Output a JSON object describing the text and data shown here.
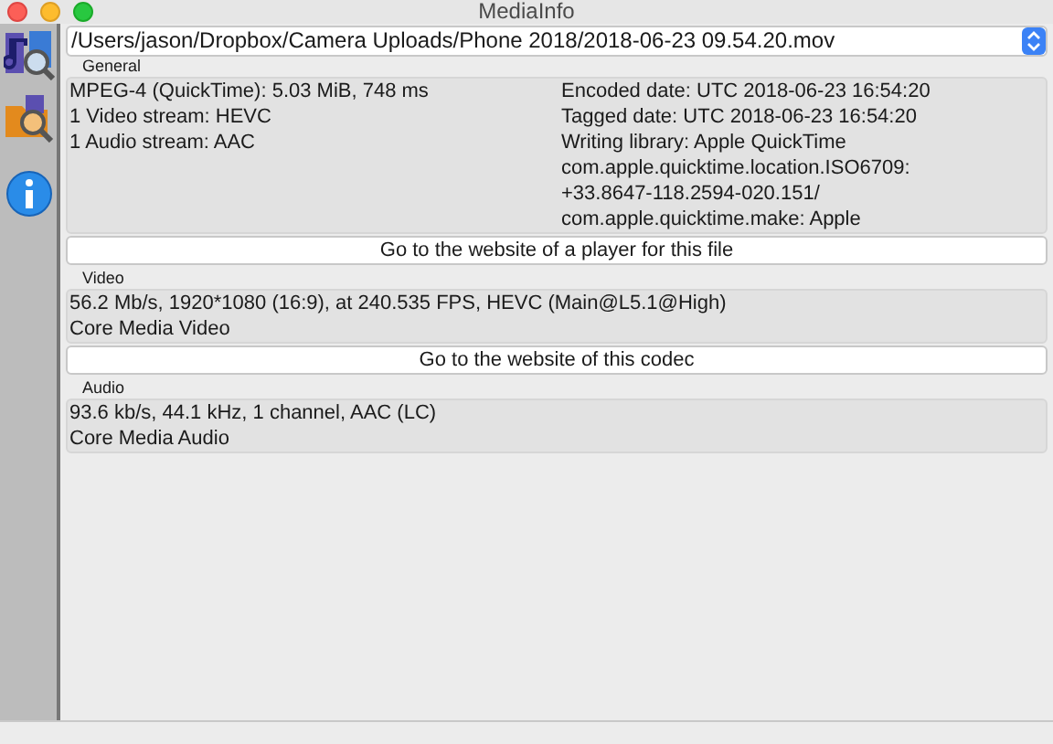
{
  "window": {
    "title": "MediaInfo"
  },
  "file_path": "/Users/jason/Dropbox/Camera Uploads/Phone 2018/2018-06-23 09.54.20.mov",
  "sections": [
    {
      "title": "General",
      "left_lines": [
        "MPEG-4 (QuickTime): 5.03 MiB, 748 ms",
        "1 Video stream: HEVC",
        "1 Audio stream: AAC"
      ],
      "right_lines": [
        "Encoded date: UTC 2018-06-23 16:54:20",
        "Tagged date: UTC 2018-06-23 16:54:20",
        "Writing library: Apple QuickTime",
        "com.apple.quicktime.location.ISO6709:",
        "+33.8647-118.2594-020.151/",
        "com.apple.quicktime.make: Apple"
      ],
      "button": "Go to the website of a player for this file"
    },
    {
      "title": "Video",
      "left_lines": [
        "56.2 Mb/s, 1920*1080 (16:9), at 240.535 FPS, HEVC (Main@L5.1@High)",
        "Core Media Video"
      ],
      "button": "Go to the website of this codec"
    },
    {
      "title": "Audio",
      "left_lines": [
        "93.6 kb/s, 44.1 kHz, 1 channel, AAC (LC)",
        "Core Media Audio"
      ]
    }
  ]
}
